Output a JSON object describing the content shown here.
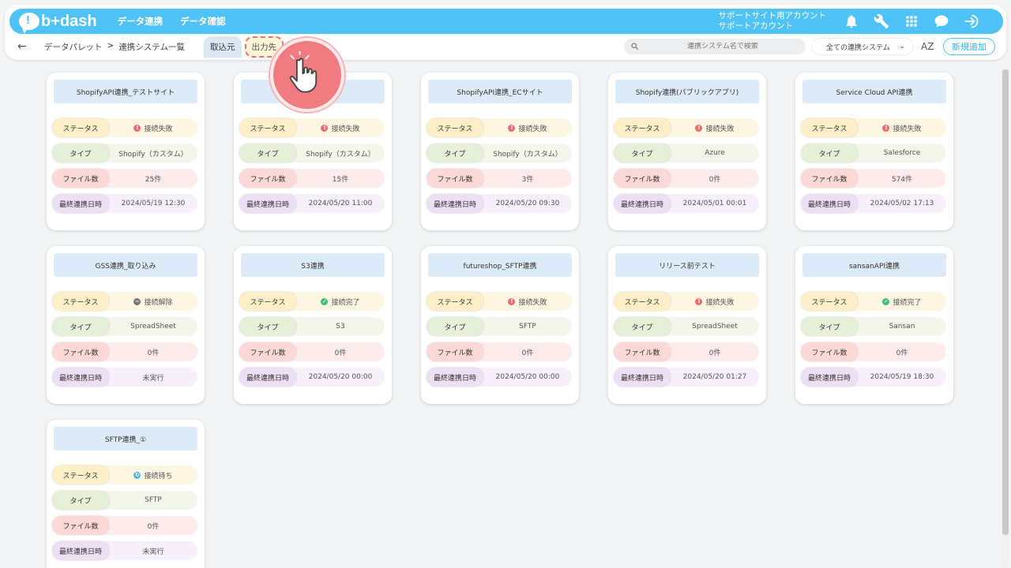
{
  "app": {
    "logo_text": "b+dash",
    "accent": "#4fc3f7"
  },
  "header": {
    "nav": [
      "データ連携",
      "データ確認"
    ],
    "account_line1": "サポートサイト用アカウント",
    "account_line2": "サポートアカウント",
    "icons": [
      "bell-icon",
      "wrench-icon",
      "grid-icon",
      "chat-icon",
      "logout-icon"
    ]
  },
  "subbar": {
    "back_icon": "←",
    "breadcrumb": [
      "データパレット",
      ">",
      "連携システム一覧"
    ],
    "tabs": {
      "in": "取込元",
      "out": "出力先"
    },
    "search_placeholder": "連携システム名で検索",
    "filter_selected": "全ての連携システム",
    "sort_label": "AZ",
    "add_button": "新規追加"
  },
  "labels": {
    "status": "ステータス",
    "type": "タイプ",
    "files": "ファイル数",
    "last": "最終連携日時"
  },
  "cards": [
    {
      "title": "ShopifyAPI連携_テストサイト",
      "status": "接続失敗",
      "status_kind": "fail",
      "type": "Shopify（カスタム）",
      "files": "25件",
      "last": "2024/05/19 12:30"
    },
    {
      "title": "",
      "status": "接続失敗",
      "status_kind": "fail",
      "type": "Shopify（カスタム）",
      "files": "15件",
      "last": "2024/05/20 11:00"
    },
    {
      "title": "ShopifyAPI連携_ECサイト",
      "status": "接続失敗",
      "status_kind": "fail",
      "type": "Shopify（カスタム）",
      "files": "3件",
      "last": "2024/05/20 09:30"
    },
    {
      "title": "Shopify連携(パブリックアプリ)",
      "status": "接続失敗",
      "status_kind": "fail",
      "type": "Azure",
      "files": "0件",
      "last": "2024/05/01 00:01"
    },
    {
      "title": "Service Cloud API連携",
      "status": "接続失敗",
      "status_kind": "fail",
      "type": "Salesforce",
      "files": "574件",
      "last": "2024/05/02 17:13"
    },
    {
      "title": "GSS連携_取り込み",
      "status": "接続解除",
      "status_kind": "off",
      "type": "SpreadSheet",
      "files": "0件",
      "last": "未実行"
    },
    {
      "title": "S3連携",
      "status": "接続完了",
      "status_kind": "ok",
      "type": "S3",
      "files": "0件",
      "last": "2024/05/20 00:00"
    },
    {
      "title": "futureshop_SFTP連携",
      "status": "接続失敗",
      "status_kind": "fail",
      "type": "SFTP",
      "files": "0件",
      "last": "2024/05/20 00:00"
    },
    {
      "title": "リリース前テスト",
      "status": "接続失敗",
      "status_kind": "fail",
      "type": "SpreadSheet",
      "files": "0件",
      "last": "2024/05/20 01:27"
    },
    {
      "title": "sansanAPI連携",
      "status": "接続完了",
      "status_kind": "ok",
      "type": "Sansan",
      "files": "0件",
      "last": "2024/05/19 18:30"
    },
    {
      "title": "SFTP連携_①",
      "status": "接続待ち",
      "status_kind": "wait",
      "type": "SFTP",
      "files": "0件",
      "last": "未実行"
    }
  ]
}
